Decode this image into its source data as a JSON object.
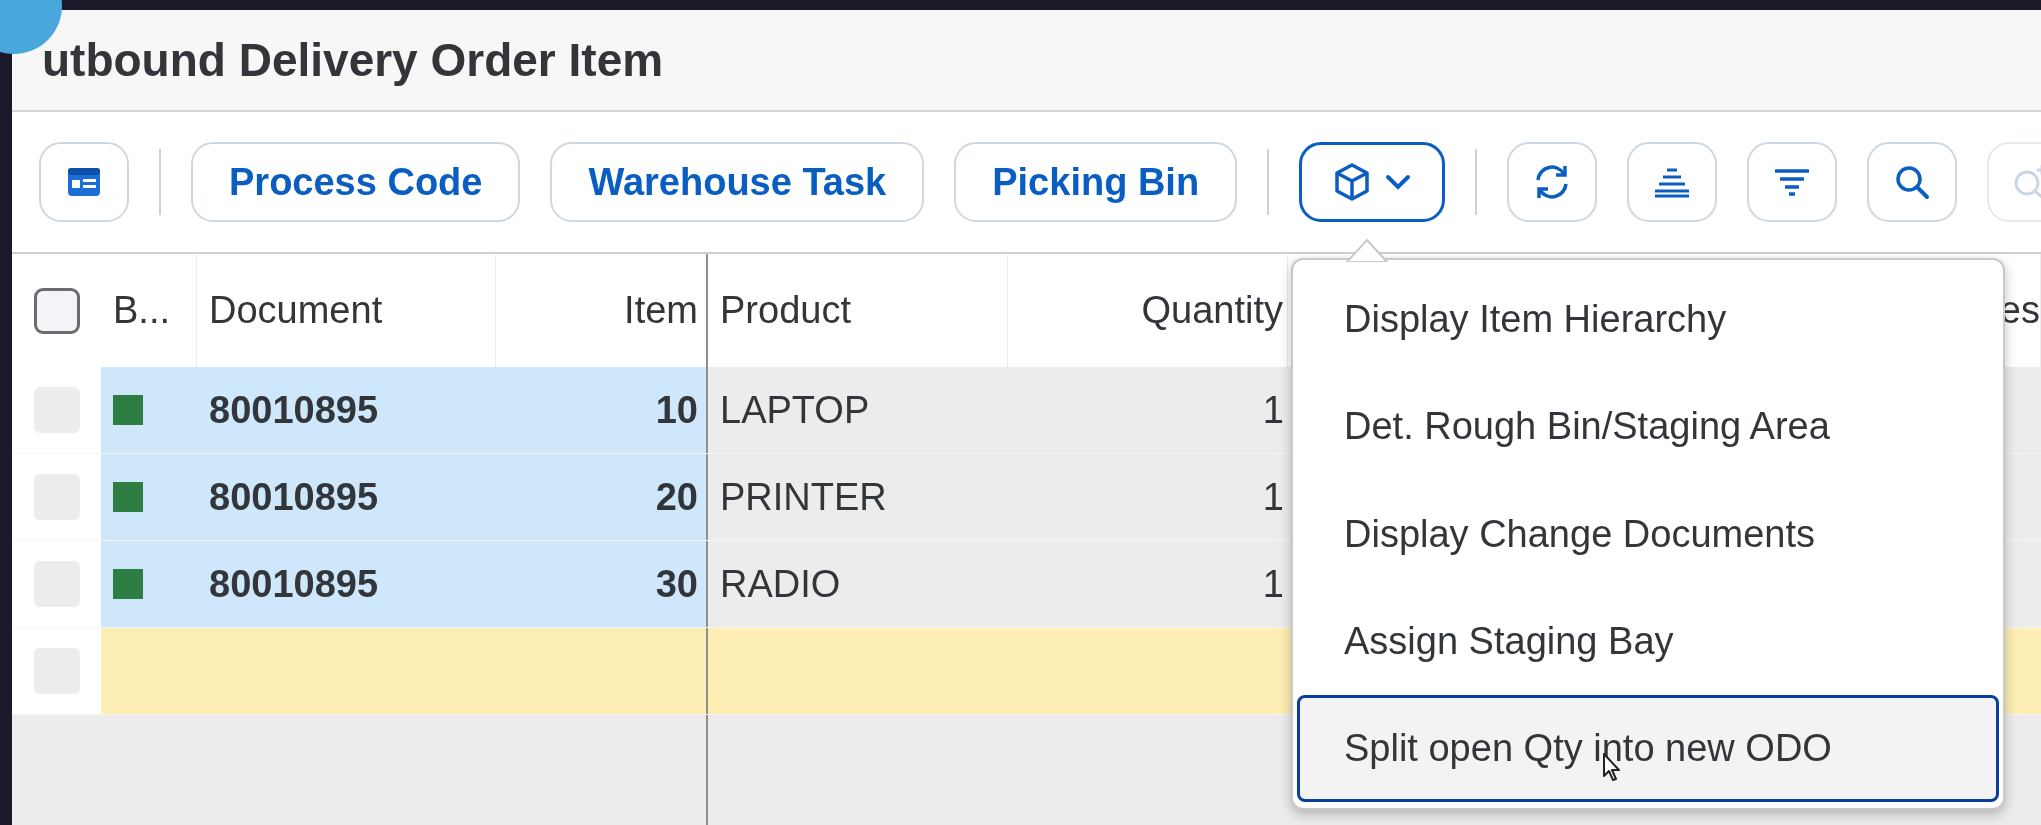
{
  "title": "utbound Delivery Order Item",
  "toolbar": [
    {
      "kind": "layout"
    },
    {
      "kind": "separator"
    },
    {
      "kind": "text",
      "label": "Process Code"
    },
    {
      "kind": "text",
      "label": "Warehouse Task"
    },
    {
      "kind": "text",
      "label": "Picking Bin"
    },
    {
      "kind": "separator"
    },
    {
      "kind": "menu",
      "expanded": true
    },
    {
      "kind": "separator"
    },
    {
      "kind": "refresh"
    },
    {
      "kind": "sort"
    },
    {
      "kind": "filter"
    },
    {
      "kind": "search"
    },
    {
      "kind": "zoom",
      "disabled": true
    }
  ],
  "table": {
    "select_all": {
      "checked": false
    },
    "columns": [
      "B...",
      "Document",
      "Item",
      "Product",
      "Quantity",
      "es"
    ],
    "rows": [
      {
        "selected": true,
        "highlighted": false,
        "color": "#2e7d43",
        "document": "80010895",
        "item": "10",
        "product": "LAPTOP",
        "quantity": "1"
      },
      {
        "selected": true,
        "highlighted": false,
        "color": "#2e7d43",
        "document": "80010895",
        "item": "20",
        "product": "PRINTER",
        "quantity": "1"
      },
      {
        "selected": true,
        "highlighted": false,
        "color": "#2e7d43",
        "document": "80010895",
        "item": "30",
        "product": "RADIO",
        "quantity": "1"
      },
      {
        "selected": false,
        "highlighted": true
      }
    ]
  },
  "menu": {
    "items": [
      {
        "label": "Display Item Hierarchy",
        "selected": false
      },
      {
        "label": "Det. Rough Bin/Staging Area",
        "selected": false
      },
      {
        "label": "Display Change Documents",
        "selected": false
      },
      {
        "label": "Assign Staging Bay",
        "selected": false
      },
      {
        "label": "Split open Qty into new ODO",
        "selected": true
      }
    ]
  }
}
